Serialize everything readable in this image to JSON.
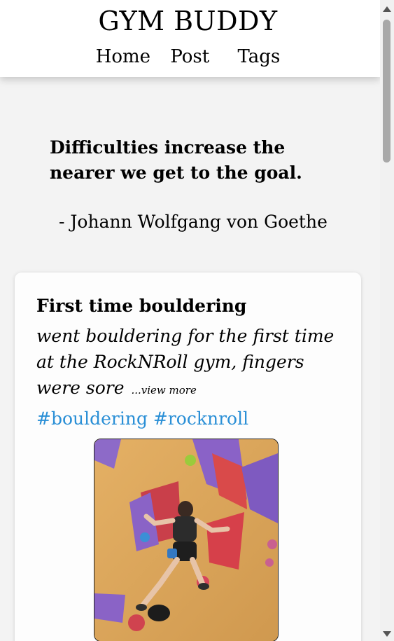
{
  "header": {
    "brand": "GYM BUDDY",
    "nav": [
      {
        "label": "Home"
      },
      {
        "label": "Post"
      },
      {
        "label": "Tags"
      }
    ]
  },
  "quote": {
    "text": "Difficulties increase the nearer we get to the goal.",
    "author": "- Johann Wolfgang von Goethe"
  },
  "post": {
    "title": "First time bouldering",
    "body": "went bouldering for the first time at the RockNRoll gym, fingers were sore",
    "view_more": "...view more",
    "tags": [
      "#bouldering",
      "#rocknroll"
    ],
    "image_icon": "climber-photo"
  },
  "colors": {
    "page_bg": "#f3f3f3",
    "tag_link": "#2a8fd6"
  }
}
